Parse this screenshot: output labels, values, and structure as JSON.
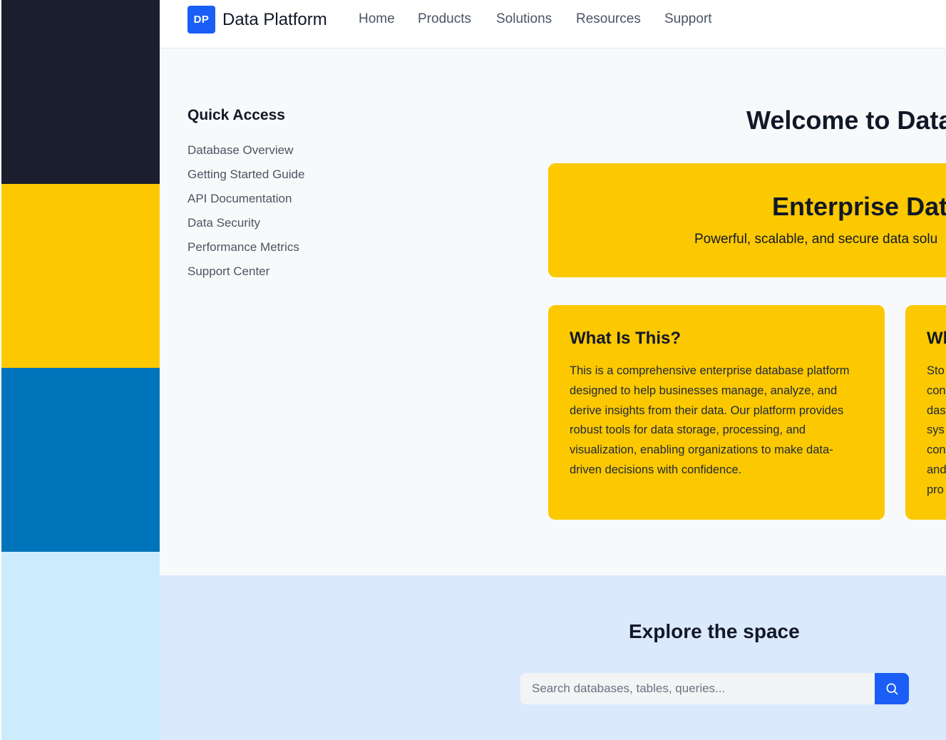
{
  "colors": {
    "stripe_1": "#1b1e2c",
    "stripe_2": "#fcc800",
    "stripe_3": "#0074bb",
    "stripe_4": "#cbecfc",
    "brand_blue": "#1a5ef5",
    "card_yellow": "#fcc800",
    "explore_bg": "#dbe9fd"
  },
  "header": {
    "logo_initials": "DP",
    "brand_name": "Data Platform",
    "nav": [
      "Home",
      "Products",
      "Solutions",
      "Resources",
      "Support"
    ]
  },
  "sidebar": {
    "title": "Quick Access",
    "items": [
      "Database Overview",
      "Getting Started Guide",
      "API Documentation",
      "Data Security",
      "Performance Metrics",
      "Support Center"
    ]
  },
  "main": {
    "welcome": "Welcome to Data",
    "hero": {
      "title": "Enterprise Dat",
      "subtitle": "Powerful, scalable, and secure data solu"
    },
    "cards": [
      {
        "title": "What Is This?",
        "body": "This is a comprehensive enterprise database platform designed to help businesses manage, analyze, and derive insights from their data. Our platform provides robust tools for data storage, processing, and visualization, enabling organizations to make data-driven decisions with confidence."
      },
      {
        "title": "Wh",
        "lines": [
          "Sto",
          "con",
          "das",
          "sys",
          "con",
          "and",
          "pro"
        ]
      }
    ]
  },
  "explore": {
    "title": "Explore the space",
    "search_placeholder": "Search databases, tables, queries...",
    "search_icon": "search-icon"
  }
}
